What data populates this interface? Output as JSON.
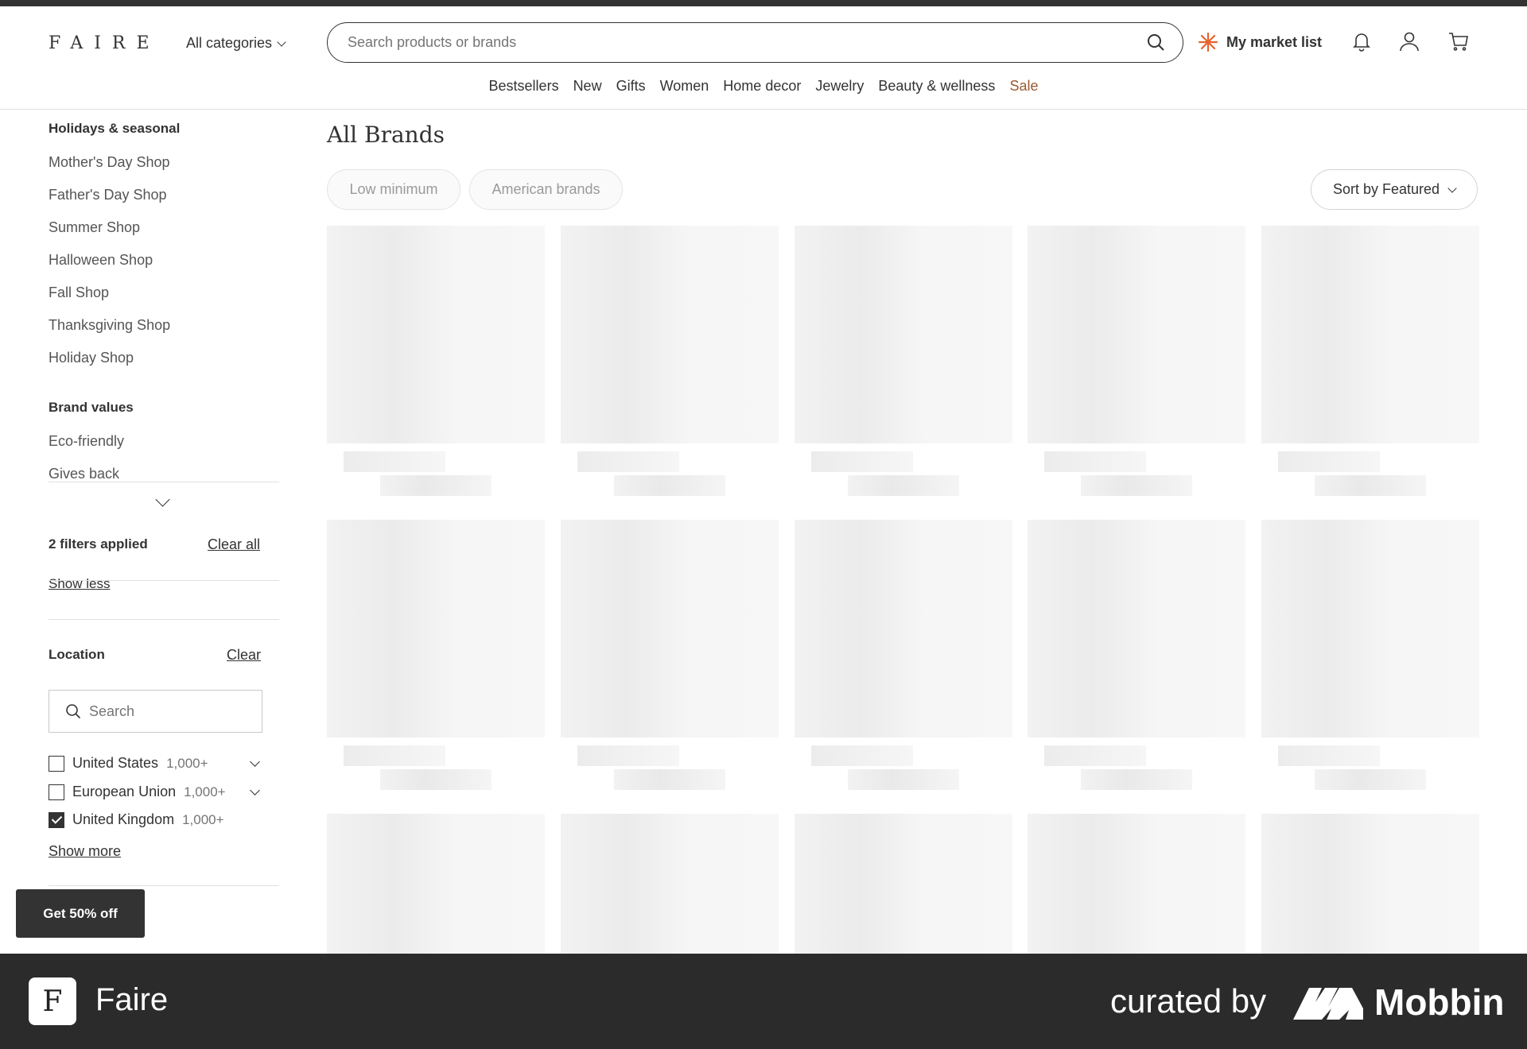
{
  "header": {
    "logo": "FAIRE",
    "all_categories": "All categories",
    "search_placeholder": "Search products or brands",
    "market_list": "My market list",
    "nav": [
      "Bestsellers",
      "New",
      "Gifts",
      "Women",
      "Home decor",
      "Jewelry",
      "Beauty & wellness",
      "Sale"
    ]
  },
  "sidebar": {
    "holidays_title": "Holidays & seasonal",
    "holidays": [
      "Mother's Day Shop",
      "Father's Day Shop",
      "Summer Shop",
      "Halloween Shop",
      "Fall Shop",
      "Thanksgiving Shop",
      "Holiday Shop"
    ],
    "brand_values_title": "Brand values",
    "brand_values": [
      "Eco-friendly",
      "Gives back"
    ],
    "filters_applied": "2 filters applied",
    "clear_all": "Clear all",
    "show_less": "Show less",
    "location_title": "Location",
    "location_clear": "Clear",
    "location_search_placeholder": "Search",
    "locations": [
      {
        "name": "United States",
        "count": "1,000+",
        "checked": false
      },
      {
        "name": "European Union",
        "count": "1,000+",
        "checked": false
      },
      {
        "name": "United Kingdom",
        "count": "1,000+",
        "checked": true
      }
    ],
    "show_more": "Show more"
  },
  "main": {
    "title": "All Brands",
    "chips": [
      "Low minimum",
      "American brands"
    ],
    "sort_label": "Sort by Featured"
  },
  "promo": {
    "label": "Get 50% off"
  },
  "banner": {
    "app_initial": "F",
    "app_name": "Faire",
    "curated_by": "curated by",
    "brand": "Mobbin"
  }
}
